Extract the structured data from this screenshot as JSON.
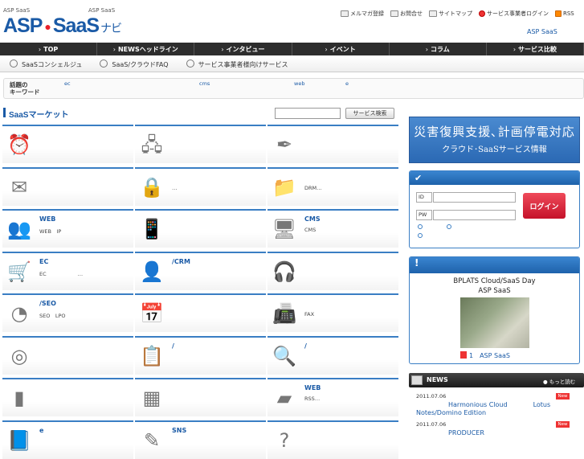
{
  "header": {
    "tagline_left": "ASP SaaS",
    "tagline_right": "ASP SaaS",
    "logo_part1": "ASP",
    "logo_part2": "SaaS",
    "logo_suffix": "ナビ",
    "top_links": [
      "メルマガ登録",
      "お問合せ",
      "サイトマップ",
      "サービス事業者ログイン",
      "RSS"
    ],
    "site_name": "ASP SaaS"
  },
  "nav": [
    "TOP",
    "NEWSヘッドライン",
    "インタビュー",
    "イベント",
    "コラム",
    "サービス比較"
  ],
  "subnav": [
    "SaaSコンシェルジュ",
    "SaaS/クラウドFAQ",
    "サービス事業者様向けサービス"
  ],
  "keywords": {
    "label_line1": "話題の",
    "label_line2": "キーワード",
    "words": [
      "ec",
      "cms",
      "web",
      "e"
    ]
  },
  "market": {
    "title": "SaaSマーケット",
    "search_button": "サービス検索",
    "search_placeholder": "",
    "cells": [
      {
        "label": "",
        "desc": "",
        "icon": "alarm-clock-icon"
      },
      {
        "label": "",
        "desc": "",
        "icon": "network-icon"
      },
      {
        "label": "",
        "desc": "",
        "icon": "feather-icon"
      },
      {
        "label": "",
        "desc": "",
        "icon": "envelope-icon"
      },
      {
        "label": "",
        "desc": "…",
        "icon": "padlock-icon"
      },
      {
        "label": "",
        "desc": "DRM…",
        "icon": "folder-icon"
      },
      {
        "label": "WEB",
        "desc": "WEB　IP",
        "icon": "meeting-icon"
      },
      {
        "label": "",
        "desc": "",
        "icon": "pda-icon"
      },
      {
        "label": "CMS",
        "desc": "CMS",
        "icon": "monitor-icon"
      },
      {
        "label": "EC",
        "desc": "EC　　　　　　…",
        "icon": "cart-icon"
      },
      {
        "label": "/CRM",
        "desc": "",
        "icon": "people-icon"
      },
      {
        "label": "",
        "desc": "",
        "icon": "headset-icon"
      },
      {
        "label": "/SEO",
        "desc": "SEO　LPO",
        "icon": "pie-chart-icon"
      },
      {
        "label": "",
        "desc": "",
        "icon": "calendar-icon"
      },
      {
        "label": "",
        "desc": "FAX",
        "icon": "fax-icon"
      },
      {
        "label": "",
        "desc": "",
        "icon": "film-reel-icon"
      },
      {
        "label": "/",
        "desc": "",
        "icon": "clipboard-icon"
      },
      {
        "label": "/",
        "desc": "",
        "icon": "magnifier-icon"
      },
      {
        "label": "",
        "desc": "",
        "icon": "server-icon"
      },
      {
        "label": "",
        "desc": "",
        "icon": "calculator-icon"
      },
      {
        "label": "WEB",
        "desc": "RSS…",
        "icon": "usa-map-icon"
      },
      {
        "label": "e",
        "desc": "",
        "icon": "book-icon"
      },
      {
        "label": "SNS",
        "desc": "",
        "icon": "pen-icon"
      },
      {
        "label": "",
        "desc": "",
        "icon": "question-icon"
      }
    ]
  },
  "banner": {
    "line1": "災害復興支援､計画停電対応",
    "line2": "クラウド･SaaSサービス情報"
  },
  "login": {
    "id_label": "ID",
    "pw_label": "PW",
    "button": "ログイン"
  },
  "event": {
    "title_line1": "BPLATS Cloud/SaaS Day",
    "title_line2": "ASP SaaS",
    "caption": "1　ASP SaaS"
  },
  "news": {
    "title": "NEWS",
    "more": "もっと読む",
    "badge": "New",
    "items": [
      {
        "date": "2011.07.06",
        "text": "　　　　　Harmonious Cloud　　　　Lotus Notes/Domino Edition"
      },
      {
        "date": "2011.07.06",
        "text": "　　　　　PRODUCER"
      }
    ]
  },
  "colors": {
    "brand": "#1a5aa6",
    "accent": "#e8212b",
    "nav_bg": "#2d2d2d"
  }
}
